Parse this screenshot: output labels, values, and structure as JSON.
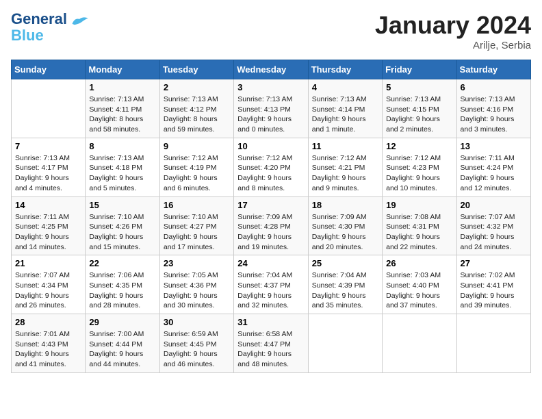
{
  "header": {
    "logo_line1": "General",
    "logo_line2": "Blue",
    "month_year": "January 2024",
    "location": "Arilje, Serbia"
  },
  "weekdays": [
    "Sunday",
    "Monday",
    "Tuesday",
    "Wednesday",
    "Thursday",
    "Friday",
    "Saturday"
  ],
  "weeks": [
    [
      {
        "day": "",
        "sunrise": "",
        "sunset": "",
        "daylight": ""
      },
      {
        "day": "1",
        "sunrise": "Sunrise: 7:13 AM",
        "sunset": "Sunset: 4:11 PM",
        "daylight": "Daylight: 8 hours and 58 minutes."
      },
      {
        "day": "2",
        "sunrise": "Sunrise: 7:13 AM",
        "sunset": "Sunset: 4:12 PM",
        "daylight": "Daylight: 8 hours and 59 minutes."
      },
      {
        "day": "3",
        "sunrise": "Sunrise: 7:13 AM",
        "sunset": "Sunset: 4:13 PM",
        "daylight": "Daylight: 9 hours and 0 minutes."
      },
      {
        "day": "4",
        "sunrise": "Sunrise: 7:13 AM",
        "sunset": "Sunset: 4:14 PM",
        "daylight": "Daylight: 9 hours and 1 minute."
      },
      {
        "day": "5",
        "sunrise": "Sunrise: 7:13 AM",
        "sunset": "Sunset: 4:15 PM",
        "daylight": "Daylight: 9 hours and 2 minutes."
      },
      {
        "day": "6",
        "sunrise": "Sunrise: 7:13 AM",
        "sunset": "Sunset: 4:16 PM",
        "daylight": "Daylight: 9 hours and 3 minutes."
      }
    ],
    [
      {
        "day": "7",
        "sunrise": "Sunrise: 7:13 AM",
        "sunset": "Sunset: 4:17 PM",
        "daylight": "Daylight: 9 hours and 4 minutes."
      },
      {
        "day": "8",
        "sunrise": "Sunrise: 7:13 AM",
        "sunset": "Sunset: 4:18 PM",
        "daylight": "Daylight: 9 hours and 5 minutes."
      },
      {
        "day": "9",
        "sunrise": "Sunrise: 7:12 AM",
        "sunset": "Sunset: 4:19 PM",
        "daylight": "Daylight: 9 hours and 6 minutes."
      },
      {
        "day": "10",
        "sunrise": "Sunrise: 7:12 AM",
        "sunset": "Sunset: 4:20 PM",
        "daylight": "Daylight: 9 hours and 8 minutes."
      },
      {
        "day": "11",
        "sunrise": "Sunrise: 7:12 AM",
        "sunset": "Sunset: 4:21 PM",
        "daylight": "Daylight: 9 hours and 9 minutes."
      },
      {
        "day": "12",
        "sunrise": "Sunrise: 7:12 AM",
        "sunset": "Sunset: 4:23 PM",
        "daylight": "Daylight: 9 hours and 10 minutes."
      },
      {
        "day": "13",
        "sunrise": "Sunrise: 7:11 AM",
        "sunset": "Sunset: 4:24 PM",
        "daylight": "Daylight: 9 hours and 12 minutes."
      }
    ],
    [
      {
        "day": "14",
        "sunrise": "Sunrise: 7:11 AM",
        "sunset": "Sunset: 4:25 PM",
        "daylight": "Daylight: 9 hours and 14 minutes."
      },
      {
        "day": "15",
        "sunrise": "Sunrise: 7:10 AM",
        "sunset": "Sunset: 4:26 PM",
        "daylight": "Daylight: 9 hours and 15 minutes."
      },
      {
        "day": "16",
        "sunrise": "Sunrise: 7:10 AM",
        "sunset": "Sunset: 4:27 PM",
        "daylight": "Daylight: 9 hours and 17 minutes."
      },
      {
        "day": "17",
        "sunrise": "Sunrise: 7:09 AM",
        "sunset": "Sunset: 4:28 PM",
        "daylight": "Daylight: 9 hours and 19 minutes."
      },
      {
        "day": "18",
        "sunrise": "Sunrise: 7:09 AM",
        "sunset": "Sunset: 4:30 PM",
        "daylight": "Daylight: 9 hours and 20 minutes."
      },
      {
        "day": "19",
        "sunrise": "Sunrise: 7:08 AM",
        "sunset": "Sunset: 4:31 PM",
        "daylight": "Daylight: 9 hours and 22 minutes."
      },
      {
        "day": "20",
        "sunrise": "Sunrise: 7:07 AM",
        "sunset": "Sunset: 4:32 PM",
        "daylight": "Daylight: 9 hours and 24 minutes."
      }
    ],
    [
      {
        "day": "21",
        "sunrise": "Sunrise: 7:07 AM",
        "sunset": "Sunset: 4:34 PM",
        "daylight": "Daylight: 9 hours and 26 minutes."
      },
      {
        "day": "22",
        "sunrise": "Sunrise: 7:06 AM",
        "sunset": "Sunset: 4:35 PM",
        "daylight": "Daylight: 9 hours and 28 minutes."
      },
      {
        "day": "23",
        "sunrise": "Sunrise: 7:05 AM",
        "sunset": "Sunset: 4:36 PM",
        "daylight": "Daylight: 9 hours and 30 minutes."
      },
      {
        "day": "24",
        "sunrise": "Sunrise: 7:04 AM",
        "sunset": "Sunset: 4:37 PM",
        "daylight": "Daylight: 9 hours and 32 minutes."
      },
      {
        "day": "25",
        "sunrise": "Sunrise: 7:04 AM",
        "sunset": "Sunset: 4:39 PM",
        "daylight": "Daylight: 9 hours and 35 minutes."
      },
      {
        "day": "26",
        "sunrise": "Sunrise: 7:03 AM",
        "sunset": "Sunset: 4:40 PM",
        "daylight": "Daylight: 9 hours and 37 minutes."
      },
      {
        "day": "27",
        "sunrise": "Sunrise: 7:02 AM",
        "sunset": "Sunset: 4:41 PM",
        "daylight": "Daylight: 9 hours and 39 minutes."
      }
    ],
    [
      {
        "day": "28",
        "sunrise": "Sunrise: 7:01 AM",
        "sunset": "Sunset: 4:43 PM",
        "daylight": "Daylight: 9 hours and 41 minutes."
      },
      {
        "day": "29",
        "sunrise": "Sunrise: 7:00 AM",
        "sunset": "Sunset: 4:44 PM",
        "daylight": "Daylight: 9 hours and 44 minutes."
      },
      {
        "day": "30",
        "sunrise": "Sunrise: 6:59 AM",
        "sunset": "Sunset: 4:45 PM",
        "daylight": "Daylight: 9 hours and 46 minutes."
      },
      {
        "day": "31",
        "sunrise": "Sunrise: 6:58 AM",
        "sunset": "Sunset: 4:47 PM",
        "daylight": "Daylight: 9 hours and 48 minutes."
      },
      {
        "day": "",
        "sunrise": "",
        "sunset": "",
        "daylight": ""
      },
      {
        "day": "",
        "sunrise": "",
        "sunset": "",
        "daylight": ""
      },
      {
        "day": "",
        "sunrise": "",
        "sunset": "",
        "daylight": ""
      }
    ]
  ]
}
